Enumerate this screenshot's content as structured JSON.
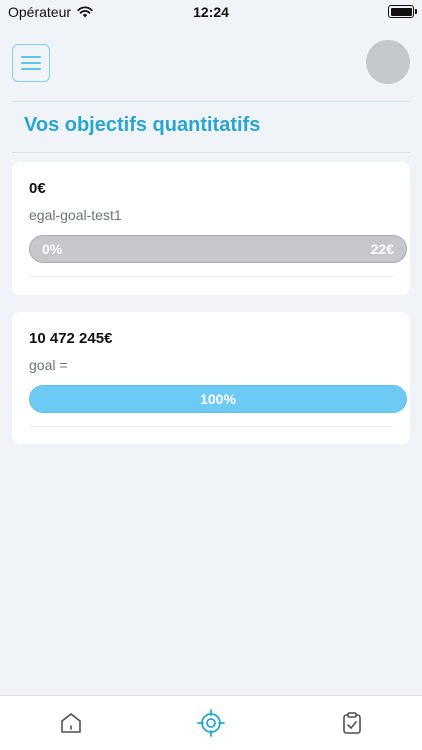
{
  "status_bar": {
    "carrier": "Opérateur",
    "time": "12:24"
  },
  "header": {
    "title": "Vos objectifs quantitatifs"
  },
  "goals": [
    {
      "amount": "0€",
      "name": "egal-goal-test1",
      "progress_fraction": 0,
      "progress_label": "0%",
      "target_label": "22€"
    },
    {
      "amount": "10 472 245€",
      "name": "goal =",
      "progress_fraction": 1,
      "progress_label": "100%"
    }
  ],
  "tab_bar": {
    "tabs": [
      {
        "icon": "home-icon",
        "active": false
      },
      {
        "icon": "target-icon",
        "active": true
      },
      {
        "icon": "clipboard-check-icon",
        "active": false
      }
    ]
  },
  "colors": {
    "accent": "#2aa5cf",
    "progress_fill": "#6ccaf5",
    "progress_track": "#c5c7cb",
    "background": "#f0f3f7"
  }
}
